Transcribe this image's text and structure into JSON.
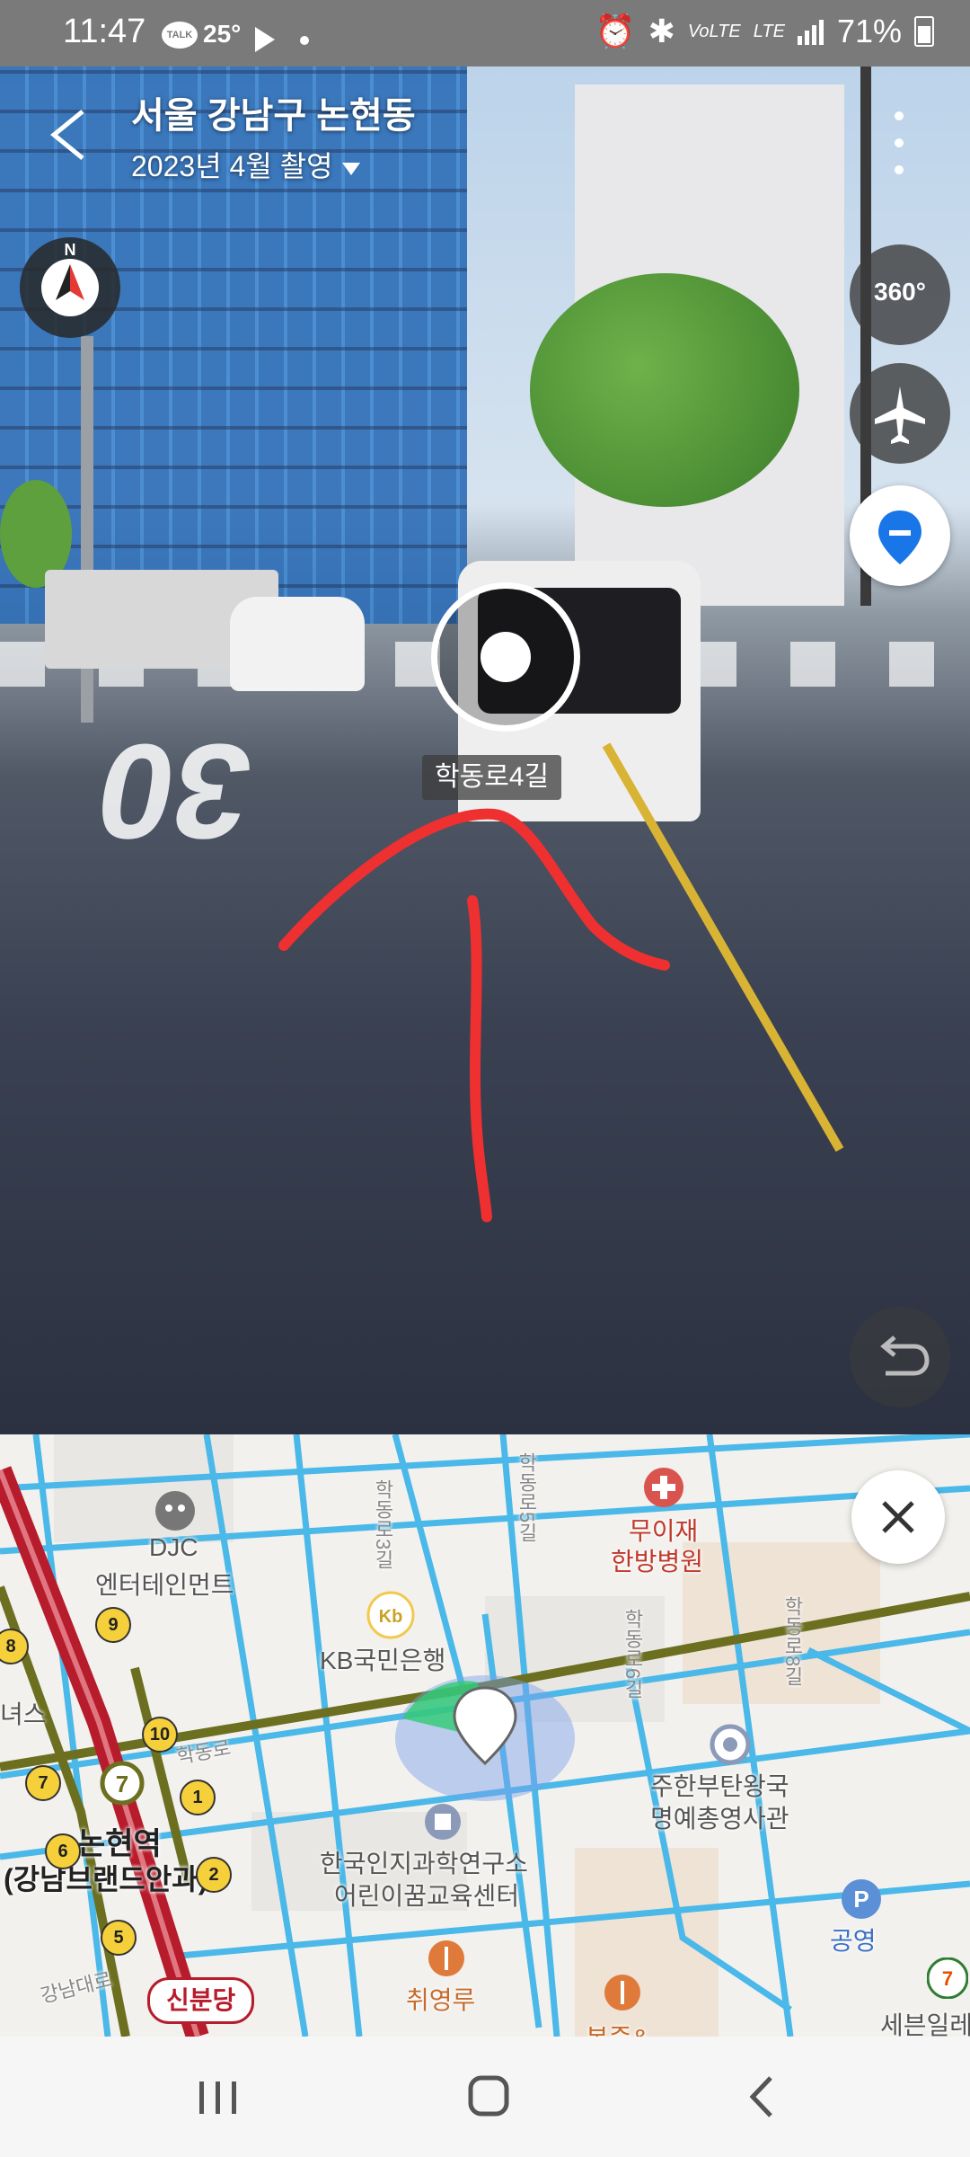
{
  "status_bar": {
    "time": "11:47",
    "talk_badge": "TALK",
    "temperature": "25°",
    "volte": "VoLTE",
    "network": "LTE",
    "battery": "71%"
  },
  "street_view": {
    "location_title": "서울 강남구 논현동",
    "capture_date": "2023년 4월 촬영",
    "compass_letter": "N",
    "btn_360": "360°",
    "road_label": "학동로4길",
    "road_marking": "30"
  },
  "map": {
    "labels": {
      "djc": "DJC",
      "djc_ent": "엔터테인먼트",
      "kb_bank": "KB국민은행",
      "hospital1": "무이재",
      "hospital2": "한방병원",
      "embassy1": "주한부탄왕국",
      "embassy2": "명예총영사관",
      "institute1": "한국인지과학연구소",
      "institute2": "어린이꿈교육센터",
      "restaurant": "취영루",
      "parking": "공영",
      "station": "논현역",
      "station_sub": "(강남브랜드안과)",
      "road_hakdong": "학동로",
      "road_hakdong3": "학동로3길",
      "road_hakdong5": "학동로5길",
      "road_hakdong6": "학동로6길",
      "road_hakdong8": "학동로8길",
      "road_gangnam": "강남대로",
      "sebin": "세븐일레",
      "left_cut": "녀스",
      "bottom_cut": "본죽&"
    },
    "station_line": "신분당",
    "exit_badges": [
      "8",
      "9",
      "10",
      "7",
      "1",
      "7",
      "6",
      "2",
      "5"
    ],
    "colors": {
      "road": "#4ab8e8",
      "subway_line7": "#6b6f1f",
      "sinbundang": "#b71c2c",
      "accuracy": "#7aa0ea"
    }
  },
  "nav_bar": {
    "recents_icon": "recents-icon",
    "home_icon": "home-icon",
    "back_icon": "back-icon"
  }
}
